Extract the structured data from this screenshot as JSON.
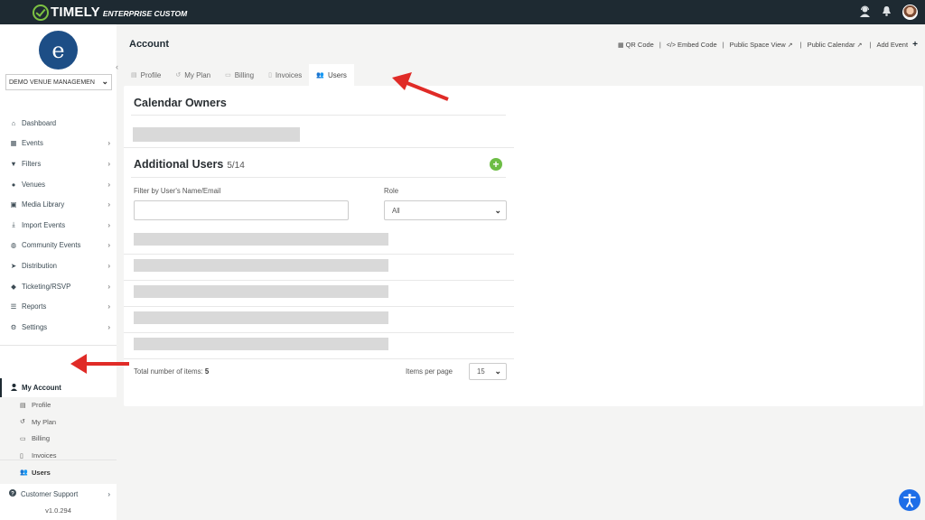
{
  "topbar": {
    "brand_name": "TIMELY",
    "brand_sub": "ENTERPRISE CUSTOM",
    "icons": [
      "support-agent-icon",
      "bell-icon",
      "user-avatar"
    ]
  },
  "sidebar": {
    "org_logo_letter": "e",
    "org_select": "DEMO VENUE MANAGEMEN",
    "collapse_glyph": "‹",
    "items": [
      {
        "label": "Dashboard",
        "icon": "home-icon",
        "glyph": "⌂",
        "has_arrow": false
      },
      {
        "label": "Events",
        "icon": "calendar-icon",
        "glyph": "▦",
        "has_arrow": true
      },
      {
        "label": "Filters",
        "icon": "filter-icon",
        "glyph": "▼",
        "has_arrow": true
      },
      {
        "label": "Venues",
        "icon": "map-marker-icon",
        "glyph": "●",
        "has_arrow": true
      },
      {
        "label": "Media Library",
        "icon": "image-icon",
        "glyph": "▣",
        "has_arrow": true
      },
      {
        "label": "Import Events",
        "icon": "download-icon",
        "glyph": "⤓",
        "has_arrow": true
      },
      {
        "label": "Community Events",
        "icon": "globe-icon",
        "glyph": "◍",
        "has_arrow": true
      },
      {
        "label": "Distribution",
        "icon": "paper-plane-icon",
        "glyph": "➤",
        "has_arrow": true
      },
      {
        "label": "Ticketing/RSVP",
        "icon": "ticket-icon",
        "glyph": "◆",
        "has_arrow": true
      },
      {
        "label": "Reports",
        "icon": "list-icon",
        "glyph": "☰",
        "has_arrow": true
      },
      {
        "label": "Settings",
        "icon": "cogs-icon",
        "glyph": "⚙",
        "has_arrow": true
      }
    ],
    "account": {
      "label": "My Account",
      "glyph": "👤",
      "subitems": [
        {
          "label": "Profile",
          "icon": "id-card-icon",
          "glyph": "▤",
          "active": false
        },
        {
          "label": "My Plan",
          "icon": "history-icon",
          "glyph": "↺",
          "active": false
        },
        {
          "label": "Billing",
          "icon": "credit-card-icon",
          "glyph": "▭",
          "active": false
        },
        {
          "label": "Invoices",
          "icon": "file-icon",
          "glyph": "▯",
          "active": false
        },
        {
          "label": "Users",
          "icon": "users-icon",
          "glyph": "👥",
          "active": true
        }
      ]
    },
    "support_label": "Customer Support",
    "version": "v1.0.294"
  },
  "header": {
    "title": "Account",
    "links": [
      {
        "label": "QR Code",
        "glyph": "▦",
        "icon": "qr-code-icon"
      },
      {
        "label": "Embed Code",
        "glyph": "</>",
        "icon": "code-icon"
      },
      {
        "label": "Public Space View",
        "glyph": "↗",
        "icon": "external-link-icon",
        "trailing": true
      },
      {
        "label": "Public Calendar",
        "glyph": "↗",
        "icon": "external-link-icon",
        "trailing": true
      },
      {
        "label": "Add Event",
        "glyph": "+",
        "icon": "plus-icon",
        "trailing": true
      }
    ]
  },
  "tabs": [
    {
      "label": "Profile",
      "glyph": "▤",
      "icon": "id-card-icon",
      "active": false
    },
    {
      "label": "My Plan",
      "glyph": "↺",
      "icon": "history-icon",
      "active": false
    },
    {
      "label": "Billing",
      "glyph": "▭",
      "icon": "credit-card-icon",
      "active": false
    },
    {
      "label": "Invoices",
      "glyph": "▯",
      "icon": "file-icon",
      "active": false
    },
    {
      "label": "Users",
      "glyph": "👥",
      "icon": "users-icon",
      "active": true
    }
  ],
  "panel": {
    "owners_title": "Calendar Owners",
    "additional_title": "Additional Users",
    "additional_count": "5/14",
    "add_glyph": "+",
    "filter_label": "Filter by User's Name/Email",
    "filter_value": "",
    "filter_placeholder": "",
    "role_label": "Role",
    "role_value": "All",
    "total_label": "Total number of items:",
    "total_value": "5",
    "per_page_label": "Items per page",
    "per_page_value": "15"
  },
  "a11y_glyph": "♿"
}
